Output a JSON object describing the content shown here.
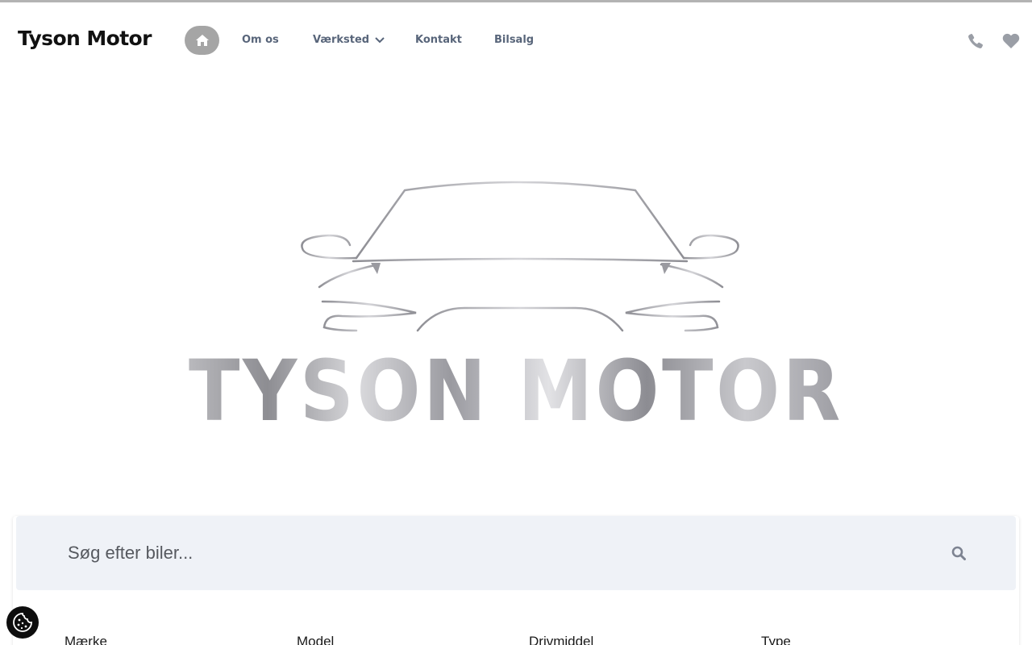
{
  "header": {
    "logo_text": "Tyson Motor",
    "home_icon": "home-icon",
    "nav": {
      "om_os": "Om os",
      "vaerksted": "Værksted",
      "kontakt": "Kontakt",
      "bilsalg": "Bilsalg"
    },
    "phone_icon": "phone-icon",
    "favorites_icon": "heart-icon"
  },
  "hero": {
    "logo_text": "TYSON MOTOR"
  },
  "search": {
    "placeholder": "Søg efter biler...",
    "icon": "search-icon"
  },
  "filters": {
    "maerke": "Mærke",
    "model": "Model",
    "drivmiddel": "Drivmiddel",
    "type": "Type"
  },
  "cookie": {
    "icon": "cookie-icon"
  },
  "colors": {
    "nav_text": "#58657a",
    "home_button": "#a5a5a5",
    "icon_gray": "#9a9ea6",
    "search_bg": "#eff2f7",
    "cookie_bg": "#0d0d0d"
  }
}
